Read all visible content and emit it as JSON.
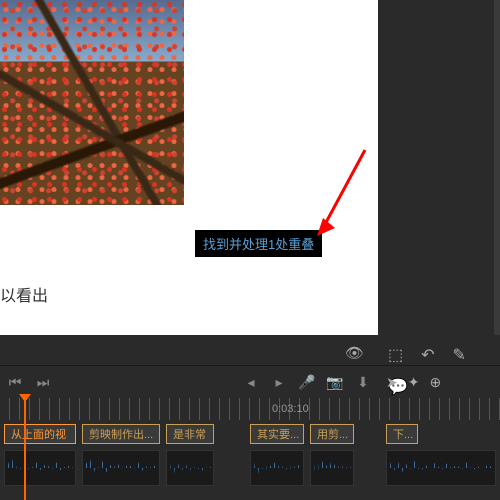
{
  "preview": {
    "caption": "以看出"
  },
  "tooltip": {
    "text": "找到并处理1处重叠"
  },
  "timeline": {
    "timecode": "0:03:10",
    "clips": [
      {
        "label": "从上面的视",
        "style": "orange",
        "width": 72
      },
      {
        "label": "剪映制作出...",
        "style": "normal",
        "width": 78
      },
      {
        "label": "是非常",
        "style": "normal",
        "width": 48
      },
      {
        "label": "其实要...",
        "style": "normal",
        "width": 54
      },
      {
        "label": "用剪...",
        "style": "normal",
        "width": 44
      },
      {
        "label": "下...",
        "style": "normal",
        "width": 32
      }
    ]
  },
  "icons": {
    "corner": "⬚",
    "undo": "↶",
    "edit": "✎",
    "comment": "💬",
    "eye": "👁",
    "prev_chapter": "⏮",
    "next_chapter": "⏭",
    "prev": "◂",
    "next": "▸",
    "mic": "🎤",
    "camera": "📷",
    "download": "⬇",
    "cursor": "➤",
    "marker": "✦",
    "zoom": "⊕"
  }
}
